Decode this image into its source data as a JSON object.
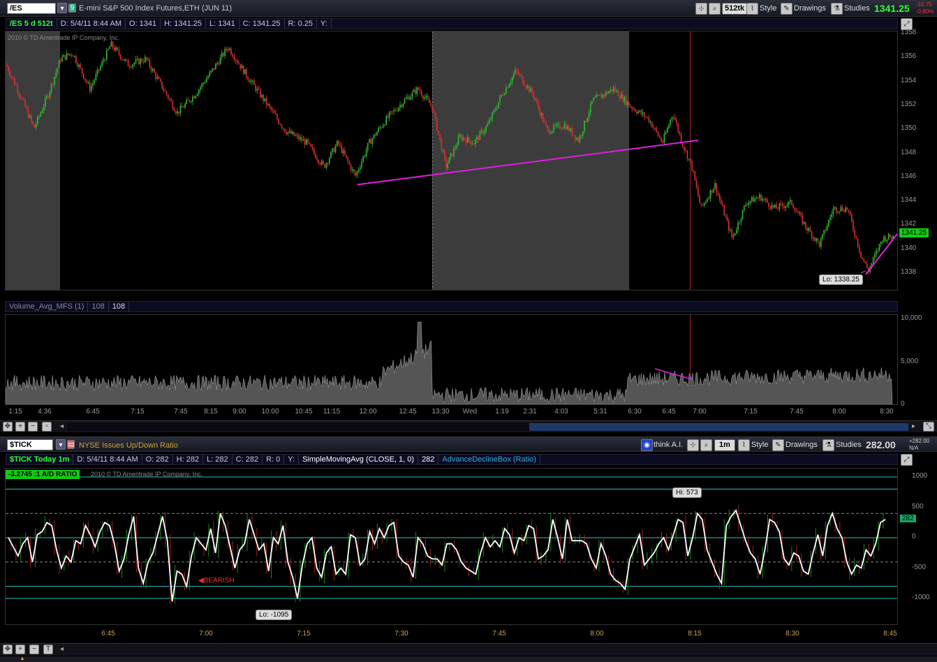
{
  "top": {
    "symbol": "/ES",
    "link_number": "9",
    "description": "E-mini S&P 500 Index Futures,ETH (JUN 11)",
    "timeframe": "512tk",
    "style_label": "Style",
    "drawings_label": "Drawings",
    "studies_label": "Studies",
    "last_price": "1341.25",
    "change": "-10.75",
    "change_pct": "-0.80%",
    "info": {
      "symbol_tf": "/ES 5 d 512t",
      "date": "D: 5/4/11 8:44 AM",
      "open": "O: 1341",
      "high": "H: 1341.25",
      "low": "L: 1341",
      "close": "C: 1341.25",
      "range": "R: 0.25",
      "y": "Y:"
    },
    "copyright": "2010 © TD Ameritrade IP Company, Inc.",
    "price_ticks": [
      "1358",
      "1356",
      "1354",
      "1352",
      "1350",
      "1348",
      "1346",
      "1344",
      "1342",
      "1340",
      "1338"
    ],
    "price_tag": "1341.25",
    "low_callout": "Lo: 1338.25",
    "volume_study": {
      "name": "Volume_Avg_MFS (1)",
      "v1": "108",
      "v2": "108",
      "ticks": [
        "10,000",
        "5,000",
        "0"
      ]
    },
    "time_ticks": [
      "1:15",
      "4:36",
      "6:45",
      "7:15",
      "7:45",
      "8:15",
      "9:00",
      "10:00",
      "10:45",
      "11:15",
      "12:00",
      "12:45",
      "13:30",
      "Wed",
      "1:19",
      "2:31",
      "4:03",
      "5:31",
      "6:30",
      "6:45",
      "7:00",
      "7:15",
      "7:45",
      "8:00",
      "8:30"
    ]
  },
  "bottom": {
    "symbol": "$TICK",
    "description": "NYSE Issues Up/Down Ratio",
    "think_ai": "think A.I.",
    "timeframe": "1m",
    "style_label": "Style",
    "drawings_label": "Drawings",
    "studies_label": "Studies",
    "last_price": "282.00",
    "change": "+282.00",
    "change_pct": "N/A",
    "info": {
      "symbol_tf": "$TICK Today 1m",
      "date": "D: 5/4/11 8:44 AM",
      "open": "O: 282",
      "high": "H: 282",
      "low": "L: 282",
      "close": "C: 282",
      "range": "R: 0",
      "y": "Y:",
      "sma": "SimpleMovingAvg (CLOSE, 1, 0)",
      "sma_val": "282",
      "adbox": "AdvanceDeclineBox (Ratio)"
    },
    "ad_ratio": "-3.2745 :1  A/D RATIO",
    "copyright": "2010 © TD Ameritrade IP Company, Inc.",
    "ticks": [
      "1000",
      "500",
      "0",
      "-500",
      "-1000"
    ],
    "price_tag": "282",
    "hi_callout": "Hi: 573",
    "lo_callout": "Lo: -1095",
    "bearish": "BEARISH",
    "time_ticks": [
      "6:45",
      "7:00",
      "7:15",
      "7:30",
      "7:45",
      "8:00",
      "8:15",
      "8:30",
      "8:45"
    ]
  },
  "colors": {
    "up": "#2fbf2f",
    "down": "#e03030",
    "trendline": "#e020e0",
    "cyan": "#30c0c0",
    "accent_green": "#33ff33"
  }
}
